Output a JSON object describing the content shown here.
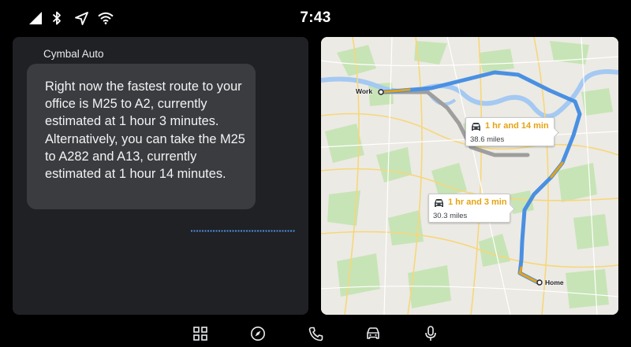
{
  "status_bar": {
    "time": "7:43",
    "icons": [
      "signal-icon",
      "bluetooth-icon",
      "navigation-arrow-icon",
      "wifi-icon"
    ]
  },
  "assistant": {
    "app_name": "Cymbal Auto",
    "message": "Right now the fastest route to your office is M25 to A2, currently estimated at 1 hour 3 minutes.  Alternatively, you can take the M25 to A282 and A13, currently estimated at 1 hour 14 minutes."
  },
  "map": {
    "places": {
      "origin": "Work",
      "destination": "Home"
    },
    "routes": [
      {
        "duration": "1 hr and 14 min",
        "distance": "38.6 miles",
        "icon": "car-icon"
      },
      {
        "duration": "1 hr and 3 min",
        "distance": "30.3 miles",
        "icon": "car-icon"
      }
    ],
    "colors": {
      "route": "#4a90e2",
      "traffic": "#e6a312",
      "water": "#a4c9f2",
      "park": "#c7e4b6"
    }
  },
  "nav_bar": {
    "items": [
      "apps-grid-icon",
      "compass-icon",
      "phone-icon",
      "car-icon",
      "microphone-icon"
    ]
  }
}
